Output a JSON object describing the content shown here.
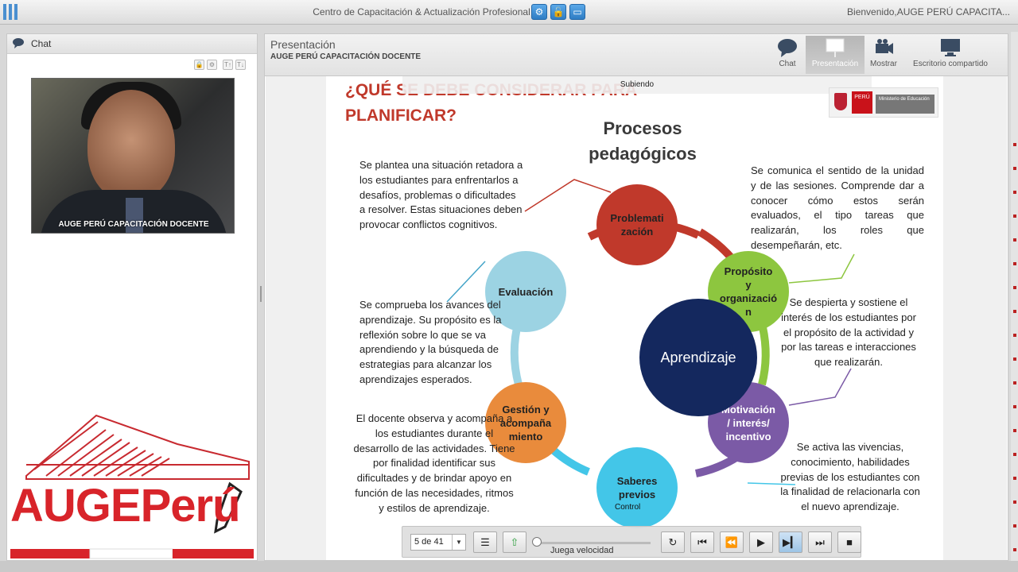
{
  "topbar": {
    "title": "Centro de Capacitación & Actualización Profesional",
    "welcome": "Bienvenido,AUGE PERÚ CAPACITA..."
  },
  "chat": {
    "title": "Chat",
    "video_caption": "AUGE PERÚ CAPACITACIÓN DOCENTE",
    "brand": "AUGEPerú"
  },
  "presentation": {
    "title": "Presentación",
    "subtitle": "AUGE PERÚ CAPACITACIÓN DOCENTE",
    "modes": [
      {
        "label": "Chat",
        "icon": "chat-bubble-icon"
      },
      {
        "label": "Presentación",
        "icon": "presentation-board-icon"
      },
      {
        "label": "Mostrar",
        "icon": "camera-icon"
      },
      {
        "label": "Escritorio compartido",
        "icon": "monitor-icon"
      }
    ],
    "uploading": "Subiendo"
  },
  "slide": {
    "title_line1": "¿QUÉ SE DEBE CONSIDERAR PARA",
    "title_line2": "PLANIFICAR?",
    "heading": "Procesos pedagógicos",
    "center": "Aprendizaje",
    "ministry": {
      "peru": "PERÚ",
      "ministry": "Ministerio de Educación"
    },
    "circles": [
      {
        "label": "Problematización",
        "color": "#c0392b"
      },
      {
        "label": "Propósito y organización",
        "color": "#8dc63f"
      },
      {
        "label": "Motivación / interés/ incentivo",
        "color": "#7b5aa6"
      },
      {
        "label": "Saberes previos",
        "color": "#43c6e8"
      },
      {
        "label": "Gestión y acompañamiento",
        "color": "#e98b3c"
      },
      {
        "label": "Evaluación",
        "color": "#9cd3e3"
      }
    ],
    "texts": {
      "problematizacion": "Se plantea una situación retadora a los estudiantes para enfrentarlos a desafíos, problemas o dificultades a resolver. Estas situaciones deben provocar conflictos cognitivos.",
      "proposito": "Se comunica el sentido de la unidad y de las sesiones. Comprende dar a conocer cómo estos serán evaluados, el tipo tareas que realizarán, los roles que desempeñarán, etc.",
      "evaluacion": "Se comprueba los avances del aprendizaje. Su propósito es la reflexión sobre lo que se va aprendiendo y la búsqueda de estrategias para alcanzar los aprendizajes esperados.",
      "motivacion": "Se despierta y sostiene el interés de los estudiantes por el propósito de la actividad y por las tareas e interacciones que realizarán.",
      "gestion": "El docente observa y acompaña a los estudiantes durante el desarrollo de las actividades. Tiene por finalidad identificar sus dificultades y de brindar apoyo en función de las necesidades, ritmos y estilos de aprendizaje.",
      "saberes": "Se activa las vivencias, conocimiento, habilidades previas de los estudiantes con la finalidad de relacionarla con el nuevo aprendizaje."
    }
  },
  "player": {
    "control_label": "Control",
    "page": "5 de 41",
    "speed_label": "Juega velocidad"
  }
}
